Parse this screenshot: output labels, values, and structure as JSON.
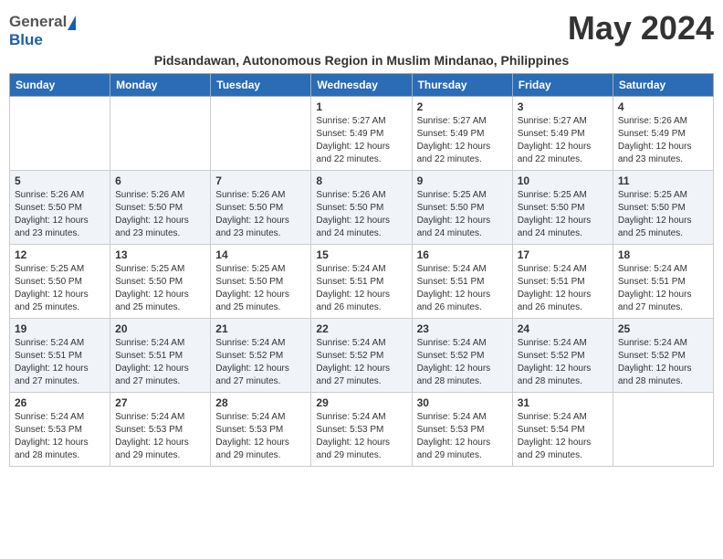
{
  "header": {
    "logo_general": "General",
    "logo_blue": "Blue",
    "month_year": "May 2024",
    "subtitle": "Pidsandawan, Autonomous Region in Muslim Mindanao, Philippines"
  },
  "days_of_week": [
    "Sunday",
    "Monday",
    "Tuesday",
    "Wednesday",
    "Thursday",
    "Friday",
    "Saturday"
  ],
  "weeks": [
    [
      {
        "day": "",
        "info": ""
      },
      {
        "day": "",
        "info": ""
      },
      {
        "day": "",
        "info": ""
      },
      {
        "day": "1",
        "info": "Sunrise: 5:27 AM\nSunset: 5:49 PM\nDaylight: 12 hours\nand 22 minutes."
      },
      {
        "day": "2",
        "info": "Sunrise: 5:27 AM\nSunset: 5:49 PM\nDaylight: 12 hours\nand 22 minutes."
      },
      {
        "day": "3",
        "info": "Sunrise: 5:27 AM\nSunset: 5:49 PM\nDaylight: 12 hours\nand 22 minutes."
      },
      {
        "day": "4",
        "info": "Sunrise: 5:26 AM\nSunset: 5:49 PM\nDaylight: 12 hours\nand 23 minutes."
      }
    ],
    [
      {
        "day": "5",
        "info": "Sunrise: 5:26 AM\nSunset: 5:50 PM\nDaylight: 12 hours\nand 23 minutes."
      },
      {
        "day": "6",
        "info": "Sunrise: 5:26 AM\nSunset: 5:50 PM\nDaylight: 12 hours\nand 23 minutes."
      },
      {
        "day": "7",
        "info": "Sunrise: 5:26 AM\nSunset: 5:50 PM\nDaylight: 12 hours\nand 23 minutes."
      },
      {
        "day": "8",
        "info": "Sunrise: 5:26 AM\nSunset: 5:50 PM\nDaylight: 12 hours\nand 24 minutes."
      },
      {
        "day": "9",
        "info": "Sunrise: 5:25 AM\nSunset: 5:50 PM\nDaylight: 12 hours\nand 24 minutes."
      },
      {
        "day": "10",
        "info": "Sunrise: 5:25 AM\nSunset: 5:50 PM\nDaylight: 12 hours\nand 24 minutes."
      },
      {
        "day": "11",
        "info": "Sunrise: 5:25 AM\nSunset: 5:50 PM\nDaylight: 12 hours\nand 25 minutes."
      }
    ],
    [
      {
        "day": "12",
        "info": "Sunrise: 5:25 AM\nSunset: 5:50 PM\nDaylight: 12 hours\nand 25 minutes."
      },
      {
        "day": "13",
        "info": "Sunrise: 5:25 AM\nSunset: 5:50 PM\nDaylight: 12 hours\nand 25 minutes."
      },
      {
        "day": "14",
        "info": "Sunrise: 5:25 AM\nSunset: 5:50 PM\nDaylight: 12 hours\nand 25 minutes."
      },
      {
        "day": "15",
        "info": "Sunrise: 5:24 AM\nSunset: 5:51 PM\nDaylight: 12 hours\nand 26 minutes."
      },
      {
        "day": "16",
        "info": "Sunrise: 5:24 AM\nSunset: 5:51 PM\nDaylight: 12 hours\nand 26 minutes."
      },
      {
        "day": "17",
        "info": "Sunrise: 5:24 AM\nSunset: 5:51 PM\nDaylight: 12 hours\nand 26 minutes."
      },
      {
        "day": "18",
        "info": "Sunrise: 5:24 AM\nSunset: 5:51 PM\nDaylight: 12 hours\nand 27 minutes."
      }
    ],
    [
      {
        "day": "19",
        "info": "Sunrise: 5:24 AM\nSunset: 5:51 PM\nDaylight: 12 hours\nand 27 minutes."
      },
      {
        "day": "20",
        "info": "Sunrise: 5:24 AM\nSunset: 5:51 PM\nDaylight: 12 hours\nand 27 minutes."
      },
      {
        "day": "21",
        "info": "Sunrise: 5:24 AM\nSunset: 5:52 PM\nDaylight: 12 hours\nand 27 minutes."
      },
      {
        "day": "22",
        "info": "Sunrise: 5:24 AM\nSunset: 5:52 PM\nDaylight: 12 hours\nand 27 minutes."
      },
      {
        "day": "23",
        "info": "Sunrise: 5:24 AM\nSunset: 5:52 PM\nDaylight: 12 hours\nand 28 minutes."
      },
      {
        "day": "24",
        "info": "Sunrise: 5:24 AM\nSunset: 5:52 PM\nDaylight: 12 hours\nand 28 minutes."
      },
      {
        "day": "25",
        "info": "Sunrise: 5:24 AM\nSunset: 5:52 PM\nDaylight: 12 hours\nand 28 minutes."
      }
    ],
    [
      {
        "day": "26",
        "info": "Sunrise: 5:24 AM\nSunset: 5:53 PM\nDaylight: 12 hours\nand 28 minutes."
      },
      {
        "day": "27",
        "info": "Sunrise: 5:24 AM\nSunset: 5:53 PM\nDaylight: 12 hours\nand 29 minutes."
      },
      {
        "day": "28",
        "info": "Sunrise: 5:24 AM\nSunset: 5:53 PM\nDaylight: 12 hours\nand 29 minutes."
      },
      {
        "day": "29",
        "info": "Sunrise: 5:24 AM\nSunset: 5:53 PM\nDaylight: 12 hours\nand 29 minutes."
      },
      {
        "day": "30",
        "info": "Sunrise: 5:24 AM\nSunset: 5:53 PM\nDaylight: 12 hours\nand 29 minutes."
      },
      {
        "day": "31",
        "info": "Sunrise: 5:24 AM\nSunset: 5:54 PM\nDaylight: 12 hours\nand 29 minutes."
      },
      {
        "day": "",
        "info": ""
      }
    ]
  ],
  "colors": {
    "header_bg": "#2a6cb5",
    "header_text": "#ffffff",
    "accent": "#1a5fa8"
  }
}
